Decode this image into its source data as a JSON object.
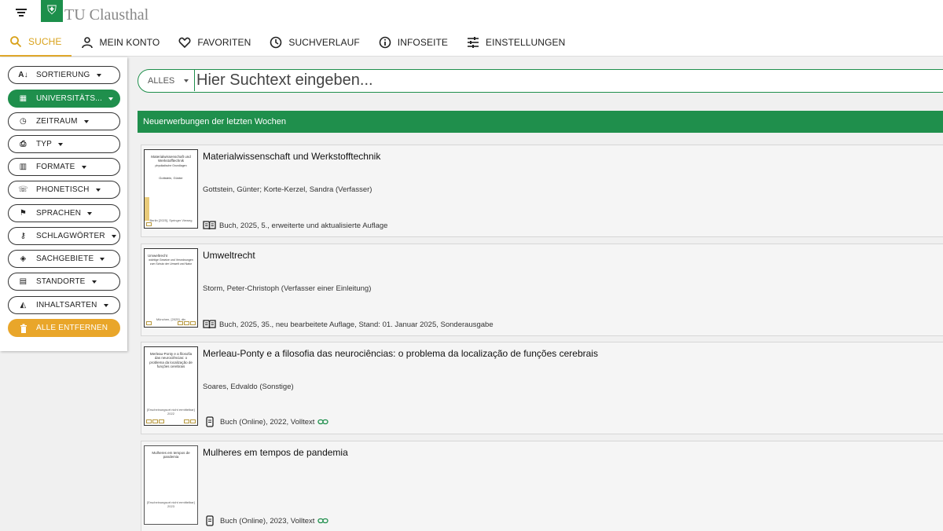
{
  "app": {
    "logo_text": "TU Clausthal",
    "logo_symbol": "⛨"
  },
  "nav": [
    {
      "label": "SUCHE",
      "icon": "search-icon",
      "active": true
    },
    {
      "label": "MEIN KONTO",
      "icon": "person-icon"
    },
    {
      "label": "FAVORITEN",
      "icon": "heart-icon"
    },
    {
      "label": "SUCHVERLAUF",
      "icon": "history-icon"
    },
    {
      "label": "INFOSEITE",
      "icon": "info-icon"
    },
    {
      "label": "EINSTELLUNGEN",
      "icon": "sliders-icon"
    }
  ],
  "filters": [
    {
      "label": "SORTIERUNG",
      "icon": "sort-az-icon",
      "glyph": "A↓"
    },
    {
      "label": "UNIVERSITÄTS...",
      "icon": "building-icon",
      "glyph": "▦",
      "state": "selected"
    },
    {
      "label": "ZEITRAUM",
      "icon": "clock-icon",
      "glyph": "◷"
    },
    {
      "label": "TYP",
      "icon": "printer-icon",
      "glyph": "⎙"
    },
    {
      "label": "FORMATE",
      "icon": "format-icon",
      "glyph": "▥"
    },
    {
      "label": "PHONETISCH",
      "icon": "phone-icon",
      "glyph": "☏"
    },
    {
      "label": "SPRACHEN",
      "icon": "flag-icon",
      "glyph": "⚑"
    },
    {
      "label": "SCHLAGWÖRTER",
      "icon": "key-icon",
      "glyph": "⚷"
    },
    {
      "label": "SACHGEBIETE",
      "icon": "tag-icon",
      "glyph": "◈"
    },
    {
      "label": "STANDORTE",
      "icon": "location-building-icon",
      "glyph": "▤"
    },
    {
      "label": "INHALTSARTEN",
      "icon": "shapes-icon",
      "glyph": "◭"
    },
    {
      "label": "ALLE ENTFERNEN",
      "icon": "trash-icon",
      "glyph": "🗑",
      "state": "action"
    }
  ],
  "search": {
    "scope": "ALLES",
    "placeholder": "Hier Suchtext eingeben..."
  },
  "section_title": "Neuerwerbungen der letzten Wochen",
  "results": [
    {
      "title": "Materialwissenschaft und Werkstofftechnik",
      "authors": "Gottstein, Günter;  Korte-Kerzel, Sandra (Verfasser)",
      "meta": "Buch, 2025, 5., erweiterte und aktualisierte Auflage",
      "media_icon": "book-icon",
      "cover_title": "Materialwissenschaft und Werkstofftechnik",
      "cover_sub": "physikalische Grundlagen",
      "cover_author": "Gottstein, Günter",
      "cover_bottom": "Berlin [2025], Springer Vieweg",
      "online": false
    },
    {
      "title": "Umweltrecht",
      "authors": "Storm, Peter-Christoph (Verfasser einer Einleitung)",
      "meta": "Buch, 2025, 35., neu bearbeitete Auflage, Stand: 01. Januar 2025, Sonderausgabe",
      "media_icon": "book-icon",
      "cover_title": "Umweltrecht",
      "cover_sub": "wichtige Gesetze und Verordnungen zum Schutz der Umwelt und Natur",
      "cover_author": "",
      "cover_bottom": "München, [2025], dtv",
      "online": false
    },
    {
      "title": "Merleau-Ponty e a filosofia das neurociências: o problema da localização de funções cerebrais",
      "authors": "Soares, Edvaldo (Sonstige)",
      "meta": "Buch (Online), 2022, Volltext",
      "media_icon": "tablet-icon",
      "cover_title": "Merleau-Ponty e a filosofia das neurociências: o problema da localização de funções cerebrais",
      "cover_sub": "",
      "cover_author": "",
      "cover_bottom": "[Erscheinungsort nicht ermittelbar] 2022",
      "online": true
    },
    {
      "title": "Mulheres em tempos de pandemia",
      "authors": "",
      "meta": "Buch (Online), 2023, Volltext",
      "media_icon": "tablet-icon",
      "cover_title": "Mulheres em tempos de pandemia",
      "cover_sub": "",
      "cover_author": "",
      "cover_bottom": "[Erscheinungsort nicht ermittelbar] 2023",
      "online": true
    }
  ],
  "colors": {
    "primary_green": "#1f8f4c",
    "accent_orange": "#e9a62a",
    "nav_active": "#d9a21b"
  }
}
